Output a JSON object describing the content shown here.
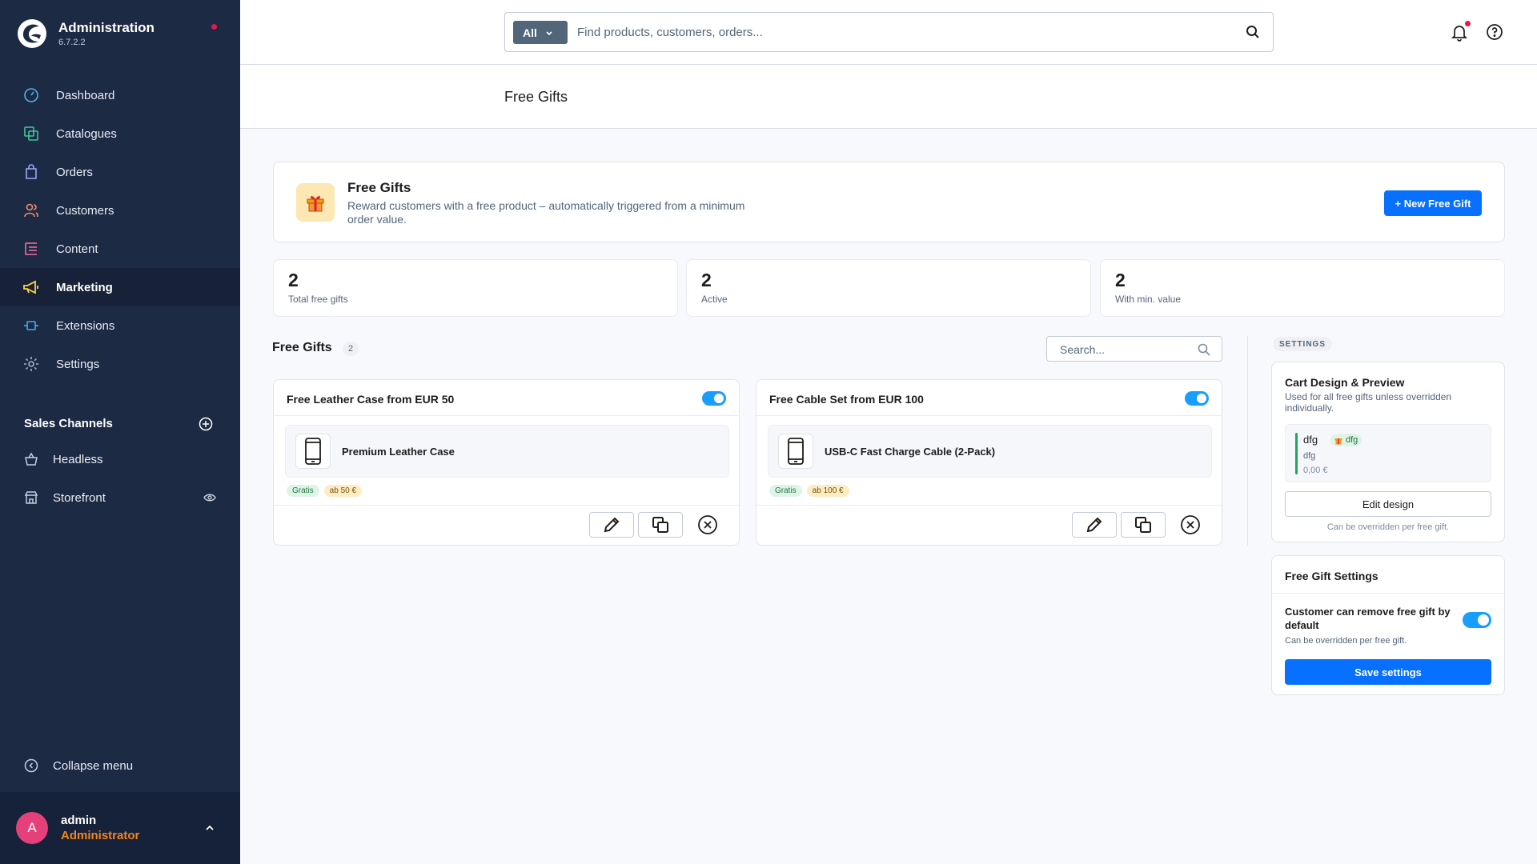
{
  "brand": {
    "title": "Administration",
    "version": "6.7.2.2"
  },
  "nav": [
    {
      "label": "Dashboard",
      "icon": "dashboard-icon"
    },
    {
      "label": "Catalogues",
      "icon": "catalogues-icon"
    },
    {
      "label": "Orders",
      "icon": "orders-icon"
    },
    {
      "label": "Customers",
      "icon": "customers-icon"
    },
    {
      "label": "Content",
      "icon": "content-icon"
    },
    {
      "label": "Marketing",
      "icon": "megaphone-icon",
      "active": true
    },
    {
      "label": "Extensions",
      "icon": "extensions-icon"
    },
    {
      "label": "Settings",
      "icon": "gear-icon"
    }
  ],
  "sales_channels": {
    "title": "Sales Channels",
    "items": [
      {
        "label": "Headless",
        "icon": "basket-icon"
      },
      {
        "label": "Storefront",
        "icon": "storefront-icon"
      }
    ]
  },
  "collapse_label": "Collapse menu",
  "user": {
    "initial": "A",
    "name": "admin",
    "role": "Administrator"
  },
  "topbar": {
    "search_type": "All",
    "search_placeholder": "Find products, customers, orders..."
  },
  "page": {
    "title": "Free Gifts"
  },
  "hero": {
    "title": "Free Gifts",
    "description": "Reward customers with a free product – automatically triggered from a minimum order value.",
    "button": "+ New Free Gift"
  },
  "stats": [
    {
      "value": "2",
      "label": "Total free gifts"
    },
    {
      "value": "2",
      "label": "Active"
    },
    {
      "value": "2",
      "label": "With min. value"
    }
  ],
  "list": {
    "title": "Free Gifts",
    "count": "2",
    "search_placeholder": "Search...",
    "gifts": [
      {
        "title": "Free Leather Case from EUR 50",
        "active": true,
        "product": "Premium Leather Case",
        "badges": [
          "Gratis",
          "ab 50 €"
        ]
      },
      {
        "title": "Free Cable Set from EUR 100",
        "active": true,
        "product": "USB-C Fast Charge Cable (2-Pack)",
        "badges": [
          "Gratis",
          "ab 100 €"
        ]
      }
    ]
  },
  "settings": {
    "label": "SETTINGS",
    "cart_design": {
      "title": "Cart Design & Preview",
      "subtitle": "Used for all free gifts unless overridden individually.",
      "preview": {
        "name": "dfg",
        "badge": "dfg",
        "sub": "dfg",
        "price": "0,00 €"
      },
      "button": "Edit design",
      "note": "Can be overridden per free gift."
    },
    "free_gift_settings": {
      "title": "Free Gift Settings",
      "option_label": "Customer can remove free gift by default",
      "option_enabled": true,
      "option_note": "Can be overridden per free gift.",
      "save": "Save settings"
    }
  },
  "colors": {
    "sidebar": "#1d2a44",
    "primary": "#0870ff",
    "toggle_on": "#189eff",
    "user_role": "#f3851c",
    "avatar": "#e5407a"
  }
}
